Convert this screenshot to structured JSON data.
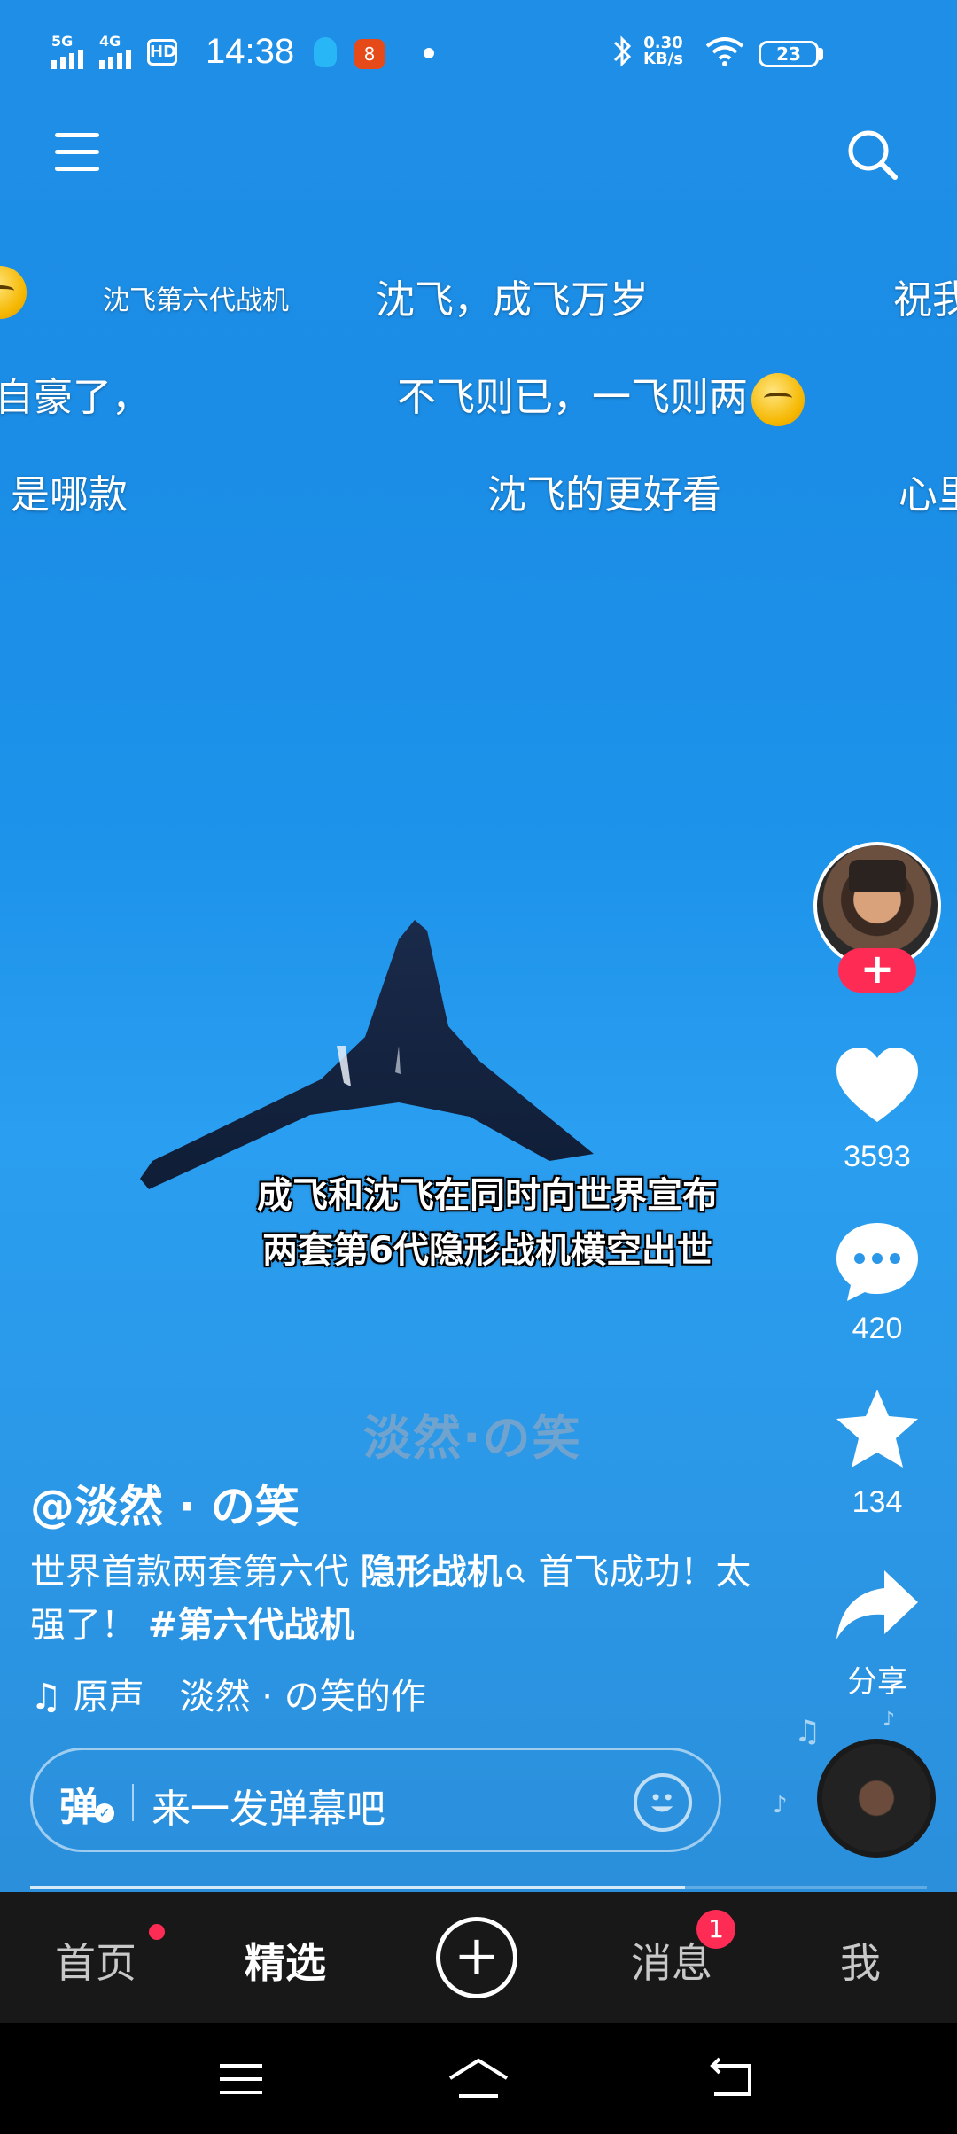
{
  "status_bar": {
    "network1": "5G",
    "network2": "4G",
    "hd": "HD",
    "time": "14:38",
    "app_icon_label": "8",
    "speed_value": "0.30",
    "speed_unit": "KB/s",
    "battery": "23"
  },
  "danmaku": [
    {
      "text": "沈飞第六代战机",
      "size": "small"
    },
    {
      "text": "沈飞，成飞万岁"
    },
    {
      "text": "祝我"
    },
    {
      "text": "自豪了，"
    },
    {
      "text": "不飞则已，一飞则两"
    },
    {
      "text": "是哪款"
    },
    {
      "text": "沈飞的更好看"
    },
    {
      "text": "心里"
    }
  ],
  "video": {
    "subtitle_line1": "成飞和沈飞在同时向世界宣布",
    "subtitle_line2": "两套第6代隐形战机横空出世",
    "watermark": "淡然·の笑"
  },
  "rail": {
    "likes": "3593",
    "comments": "420",
    "favorites": "134",
    "share_label": "分享",
    "follow_label": "+"
  },
  "caption": {
    "author": "@淡然 · の笑",
    "desc_part1": "世界首款两套第六代",
    "desc_keyword": "隐形战机",
    "desc_part2": "首飞成功！太强了！",
    "hashtag": "#第六代战机",
    "music_title": "原声",
    "music_author": "淡然 · の笑的作"
  },
  "danmaku_input": {
    "toggle_label": "弹",
    "placeholder": "来一发弹幕吧"
  },
  "progress": 0.73,
  "tabbar": {
    "home": "首页",
    "featured": "精选",
    "create": "+",
    "messages": "消息",
    "messages_badge": "1",
    "me": "我"
  }
}
